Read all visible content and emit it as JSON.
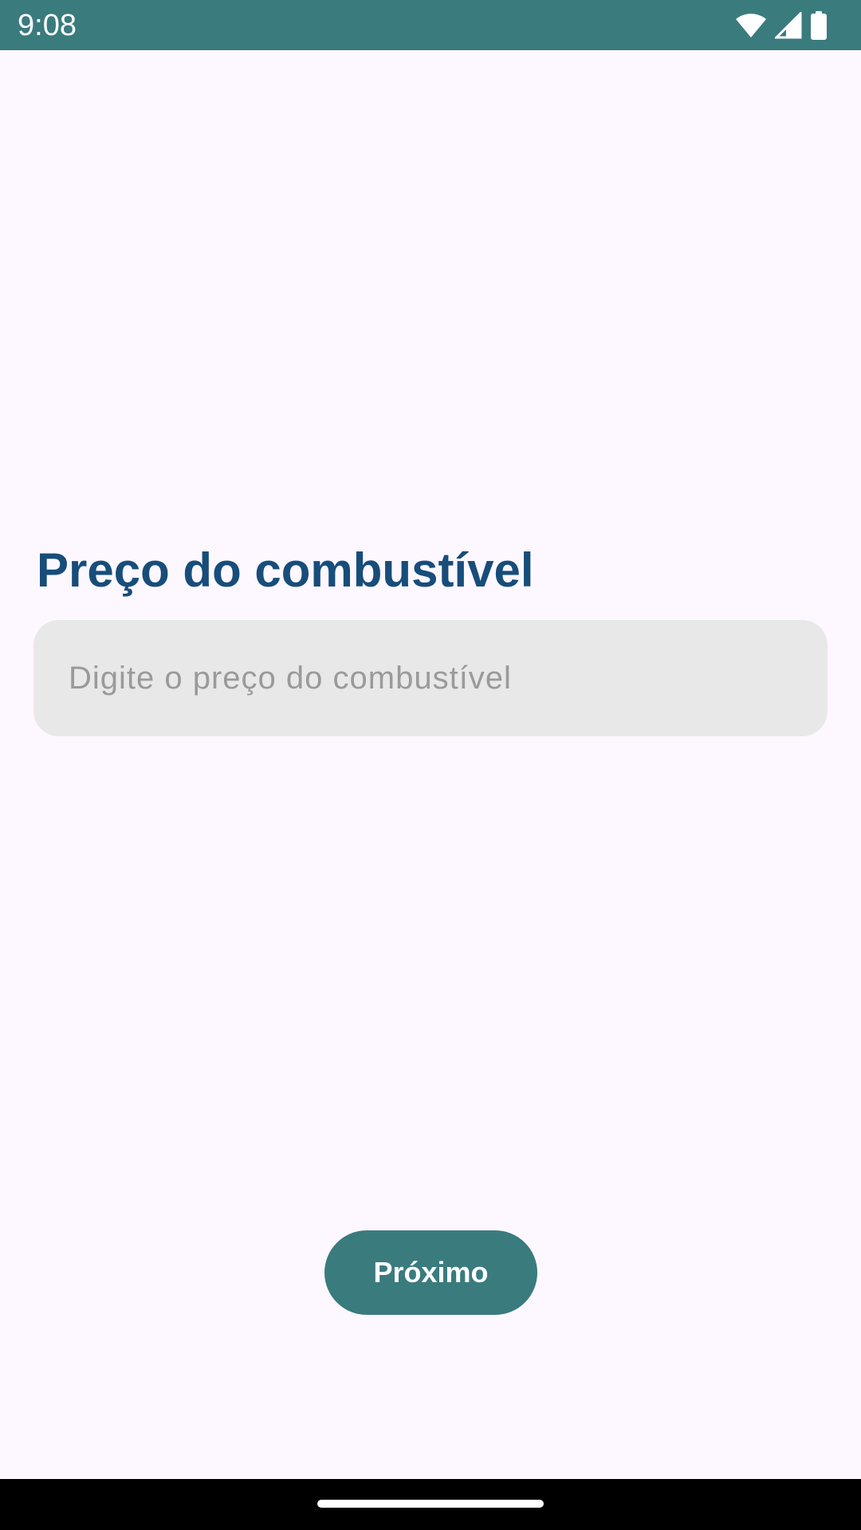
{
  "status_bar": {
    "time": "9:08",
    "icons": [
      "wifi-icon",
      "signal-icon",
      "battery-icon"
    ],
    "color": "#3A7B7E"
  },
  "main": {
    "title": "Preço do combustível",
    "title_color": "#174D7A",
    "price_input": {
      "value": "",
      "placeholder": "Digite o preço do combustível"
    },
    "next_button_label": "Próximo",
    "accent_color": "#3A7B7E"
  },
  "nav_bar": {
    "home_indicator": "home-indicator"
  }
}
